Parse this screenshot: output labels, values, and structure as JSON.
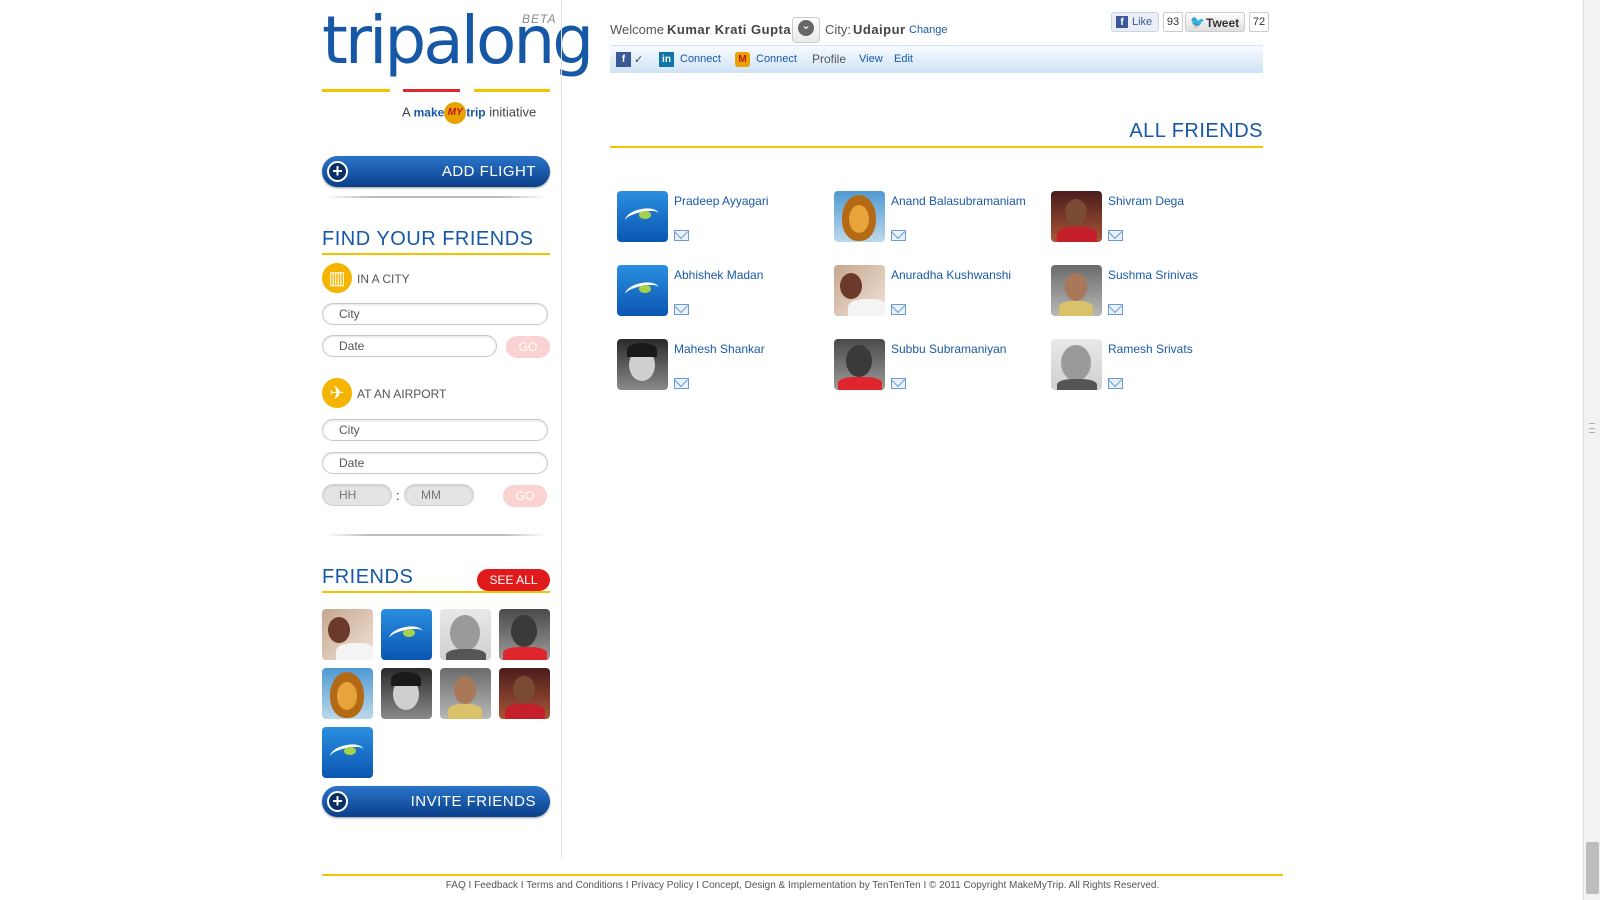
{
  "logo": {
    "brand": "tripalong",
    "beta": "BETA",
    "initiative_prefix": "A",
    "initiative_make": "make",
    "initiative_my": "MY",
    "initiative_trip": "trip",
    "initiative_suffix": "initiative",
    "line_colors": [
      "#f5c400",
      "#e0262c",
      "#f5c400"
    ]
  },
  "sidebar": {
    "add_flight_label": "ADD FLIGHT",
    "find_friends_title": "FIND YOUR FRIENDS",
    "in_city": {
      "label": "IN A CITY",
      "city_placeholder": "City",
      "date_placeholder": "Date",
      "go_label": "GO"
    },
    "at_airport": {
      "label": "AT AN AIRPORT",
      "city_placeholder": "City",
      "date_placeholder": "Date",
      "hh_placeholder": "HH",
      "mm_placeholder": "MM",
      "colon": ":",
      "go_label": "GO"
    },
    "friends_title": "FRIENDS",
    "see_all_label": "SEE ALL",
    "friend_thumbs": [
      "girl",
      "logo",
      "bald",
      "glasses",
      "lion",
      "bw",
      "woman",
      "dark",
      "logo"
    ],
    "invite_label": "INVITE FRIENDS"
  },
  "header": {
    "welcome_label": "Welcome",
    "user_name": "Kumar Krati Gupta",
    "city_label": "City:",
    "city_value": "Udaipur",
    "change_label": "Change",
    "like_label": "Like",
    "like_count": "93",
    "tweet_label": "Tweet",
    "tweet_count": "72"
  },
  "toolbar": {
    "fb_check": "✓",
    "linkedin_connect": "Connect",
    "mmt_connect": "Connect",
    "profile_label": "Profile",
    "view_label": "View",
    "edit_label": "Edit"
  },
  "main": {
    "title": "ALL FRIENDS",
    "friends": [
      {
        "name": "Pradeep Ayyagari",
        "avatar": "logo"
      },
      {
        "name": "Anand Balasubramaniam",
        "avatar": "lion"
      },
      {
        "name": "Shivram Dega",
        "avatar": "dark"
      },
      {
        "name": "Abhishek Madan",
        "avatar": "logo"
      },
      {
        "name": "Anuradha Kushwanshi",
        "avatar": "girl"
      },
      {
        "name": "Sushma Srinivas",
        "avatar": "woman"
      },
      {
        "name": "Mahesh Shankar",
        "avatar": "bw"
      },
      {
        "name": "Subbu Subramaniyan",
        "avatar": "glasses"
      },
      {
        "name": "Ramesh Srivats",
        "avatar": "bald"
      }
    ]
  },
  "footer": {
    "faq": "FAQ",
    "feedback": "Feedback",
    "terms": "Terms and Conditions",
    "privacy": "Privacy Policy",
    "credits": "Concept, Design & Implementation by TenTenTen",
    "copyright": "© 2011 Copyright MakeMyTrip. All Rights Reserved.",
    "sep": "I"
  },
  "colors": {
    "brand_blue": "#1658a6",
    "accent_yellow": "#f5c400",
    "see_all_red": "#e01a1a",
    "link_blue": "#1a5aa8"
  }
}
